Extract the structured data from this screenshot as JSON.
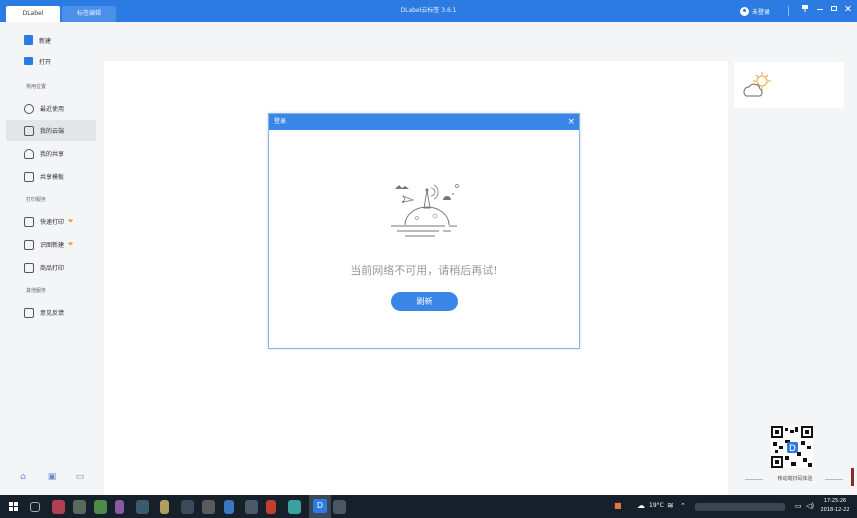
{
  "titlebar": {
    "tabs": [
      {
        "label": "DLabel",
        "active": true
      },
      {
        "label": "标签编辑",
        "active": false
      }
    ],
    "app_title": "DLabel云标签 3.6.1",
    "login_label": "未登录",
    "accent": "#2c7be3"
  },
  "sidebar": {
    "new_label": "新建",
    "open_label": "打开",
    "section_common": "常用位置",
    "items_common": [
      {
        "label": "最近使用",
        "icon": "clock-icon"
      },
      {
        "label": "我的云端",
        "icon": "document-icon",
        "selected": true
      },
      {
        "label": "我的共享",
        "icon": "user-icon"
      },
      {
        "label": "共享模板",
        "icon": "template-icon"
      }
    ],
    "section_print": "打印服务",
    "items_print": [
      {
        "label": "快速打印",
        "icon": "print-icon",
        "badge": "❤"
      },
      {
        "label": "识图新建",
        "icon": "scan-icon",
        "badge": "❤"
      },
      {
        "label": "商品打印",
        "icon": "shop-icon"
      }
    ],
    "section_other": "其他服务",
    "items_other": [
      {
        "label": "意见反馈",
        "icon": "feedback-icon"
      }
    ]
  },
  "dialog": {
    "title": "登录",
    "message": "当前网络不可用，请稍后再试!",
    "refresh_label": "刷新",
    "close_glyph": "×"
  },
  "right_panel": {
    "qr_caption": "移动端扫码体验"
  },
  "taskbar": {
    "temperature": "19°C",
    "time": "17:25:26",
    "date": "2018-12-22"
  }
}
